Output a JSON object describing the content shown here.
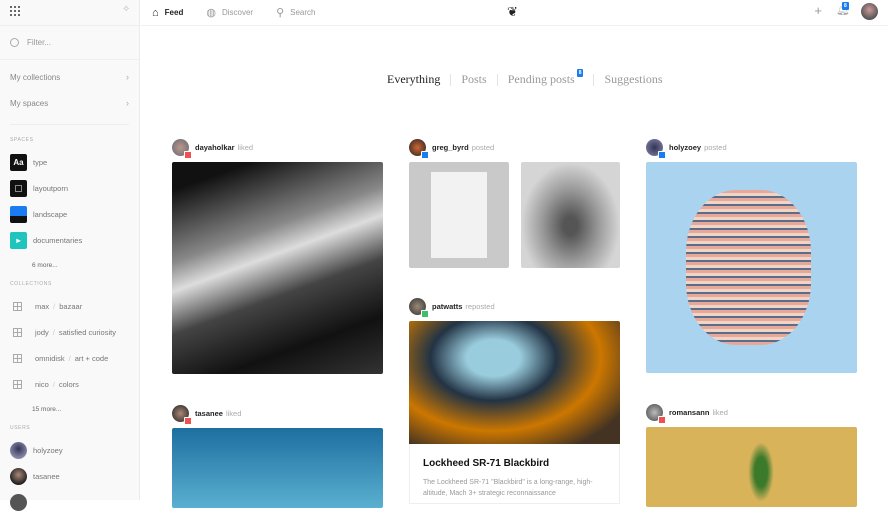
{
  "sidebar": {
    "filter_placeholder": "Filter...",
    "my_collections": "My collections",
    "my_spaces": "My spaces",
    "spaces_heading": "SPACES",
    "spaces": [
      {
        "label": "type",
        "icon": "Aa"
      },
      {
        "label": "layoutporn"
      },
      {
        "label": "landscape"
      },
      {
        "label": "documentaries"
      }
    ],
    "spaces_more": "6 more...",
    "collections_heading": "COLLECTIONS",
    "collections": [
      {
        "user": "max",
        "name": "bazaar"
      },
      {
        "user": "jody",
        "name": "satisfied curiosity"
      },
      {
        "user": "omnidisk",
        "name": "art + code"
      },
      {
        "user": "nico",
        "name": "colors"
      }
    ],
    "collections_more": "15 more...",
    "users_heading": "USERS",
    "users": [
      {
        "label": "holyzoey"
      },
      {
        "label": "tasanee"
      }
    ]
  },
  "topbar": {
    "feed": "Feed",
    "discover": "Discover",
    "search": "Search",
    "notifications_count": "8"
  },
  "tabs": [
    {
      "label": "Everything"
    },
    {
      "label": "Posts"
    },
    {
      "label": "Pending posts",
      "badge": "8"
    },
    {
      "label": "Suggestions"
    }
  ],
  "feed": [
    {
      "user": "dayaholkar",
      "action": "liked"
    },
    {
      "user": "tasanee",
      "action": "liked"
    },
    {
      "user": "greg_byrd",
      "action": "posted"
    },
    {
      "user": "patwatts",
      "action": "reposted",
      "title": "Lockheed SR-71 Blackbird",
      "excerpt": "The Lockheed SR-71 \"Blackbird\" is a long-range, high-altitude, Mach 3+ strategic reconnaissance"
    },
    {
      "user": "holyzoey",
      "action": "posted"
    },
    {
      "user": "romansann",
      "action": "liked"
    }
  ],
  "colors": {
    "accent": "#1a7cf0",
    "like": "#f0504f",
    "repost": "#3fbf6a"
  }
}
